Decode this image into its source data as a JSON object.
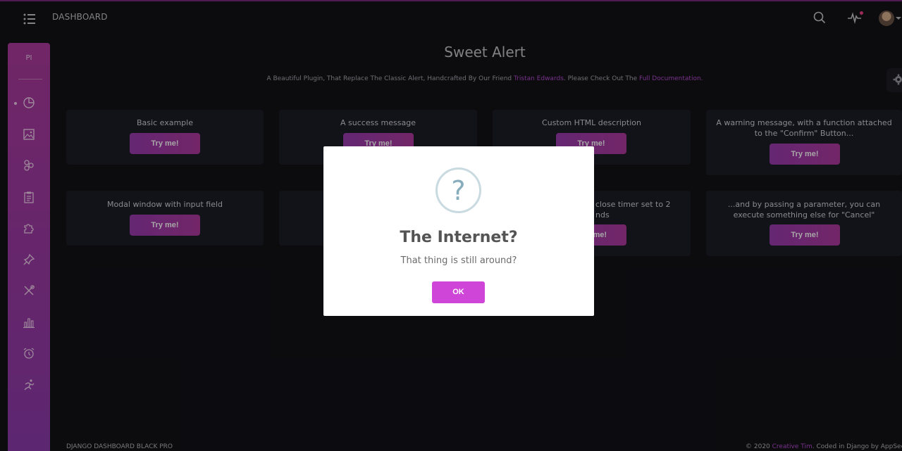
{
  "navbar": {
    "brand": "DASHBOARD"
  },
  "sidebar": {
    "logo": "PI",
    "items": [
      {
        "icon": "chart-pie-icon"
      },
      {
        "icon": "image-icon"
      },
      {
        "icon": "molecule-icon"
      },
      {
        "icon": "clipboard-icon"
      },
      {
        "icon": "puzzle-icon"
      },
      {
        "icon": "pin-icon"
      },
      {
        "icon": "tools-icon"
      },
      {
        "icon": "bar-chart-icon"
      },
      {
        "icon": "alarm-clock-icon"
      },
      {
        "icon": "runner-icon"
      }
    ]
  },
  "page": {
    "title": "Sweet Alert",
    "subtitle_pre": "A Beautiful Plugin, That Replace The Classic Alert, Handcrafted By Our Friend ",
    "subtitle_link1": "Tristan Edwards",
    "subtitle_mid": ". Please Check Out The ",
    "subtitle_link2": "Full Documentation."
  },
  "cards": [
    {
      "text": "Basic example",
      "button": "Try me!"
    },
    {
      "text": "A success message",
      "button": "Try me!"
    },
    {
      "text": "Custom HTML description",
      "button": "Try me!"
    },
    {
      "text": "A warning message, with a function attached to the \"Confirm\" Button...",
      "button": "Try me!"
    },
    {
      "text": "Modal window with input field",
      "button": "Try me!"
    },
    {
      "text": "close timer set to 2 nds",
      "button": "me!"
    },
    {
      "text": "...and by passing a parameter, you can execute something else for \"Cancel\"",
      "button": "Try me!"
    }
  ],
  "footer": {
    "left": "DJANGO DASHBOARD BLACK PRO",
    "right_pre": "© 2020 ",
    "right_link": "Creative Tim",
    "right_post": ". Coded in Django by AppSeed"
  },
  "modal": {
    "icon": "question-icon",
    "glyph": "?",
    "title": "The Internet?",
    "text": "That thing is still around?",
    "ok": "OK"
  },
  "colors": {
    "accent": "#b84dd4",
    "sidebar_top": "#ad3b9e",
    "sidebar_bottom": "#8f3bad",
    "ok_button": "#cf45d8",
    "background": "#131318"
  }
}
